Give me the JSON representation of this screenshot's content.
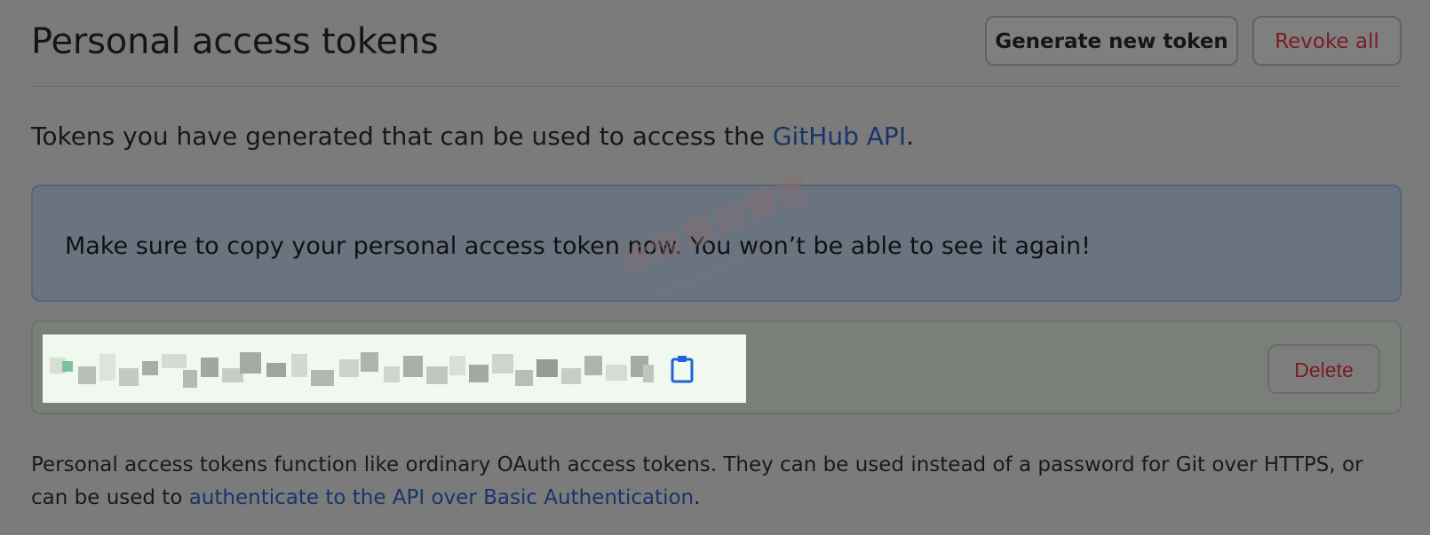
{
  "header": {
    "title": "Personal access tokens",
    "generate_label": "Generate new token",
    "revoke_label": "Revoke all"
  },
  "intro": {
    "prefix": "Tokens you have generated that can be used to access the ",
    "link": "GitHub API",
    "suffix": "."
  },
  "flash": {
    "message": "Make sure to copy your personal access token now. You won’t be able to see it again!"
  },
  "token": {
    "value": "",
    "delete_label": "Delete"
  },
  "footer": {
    "text": "Personal access tokens function like ordinary OAuth access tokens. They can be used instead of a password for Git over HTTPS, or can be used to ",
    "link": "authenticate to the API over Basic Authentication",
    "suffix": "."
  },
  "watermark": {
    "main": "徐晓康的博客",
    "sub": "MPGA/FPGA/IC一个FPGA工程师"
  },
  "colors": {
    "link": "#17356a",
    "danger": "#7a1a22",
    "flash_bg": "#6a7480",
    "token_bg": "#7b7f7a"
  },
  "icons": {
    "copy": "clipboard-icon"
  }
}
